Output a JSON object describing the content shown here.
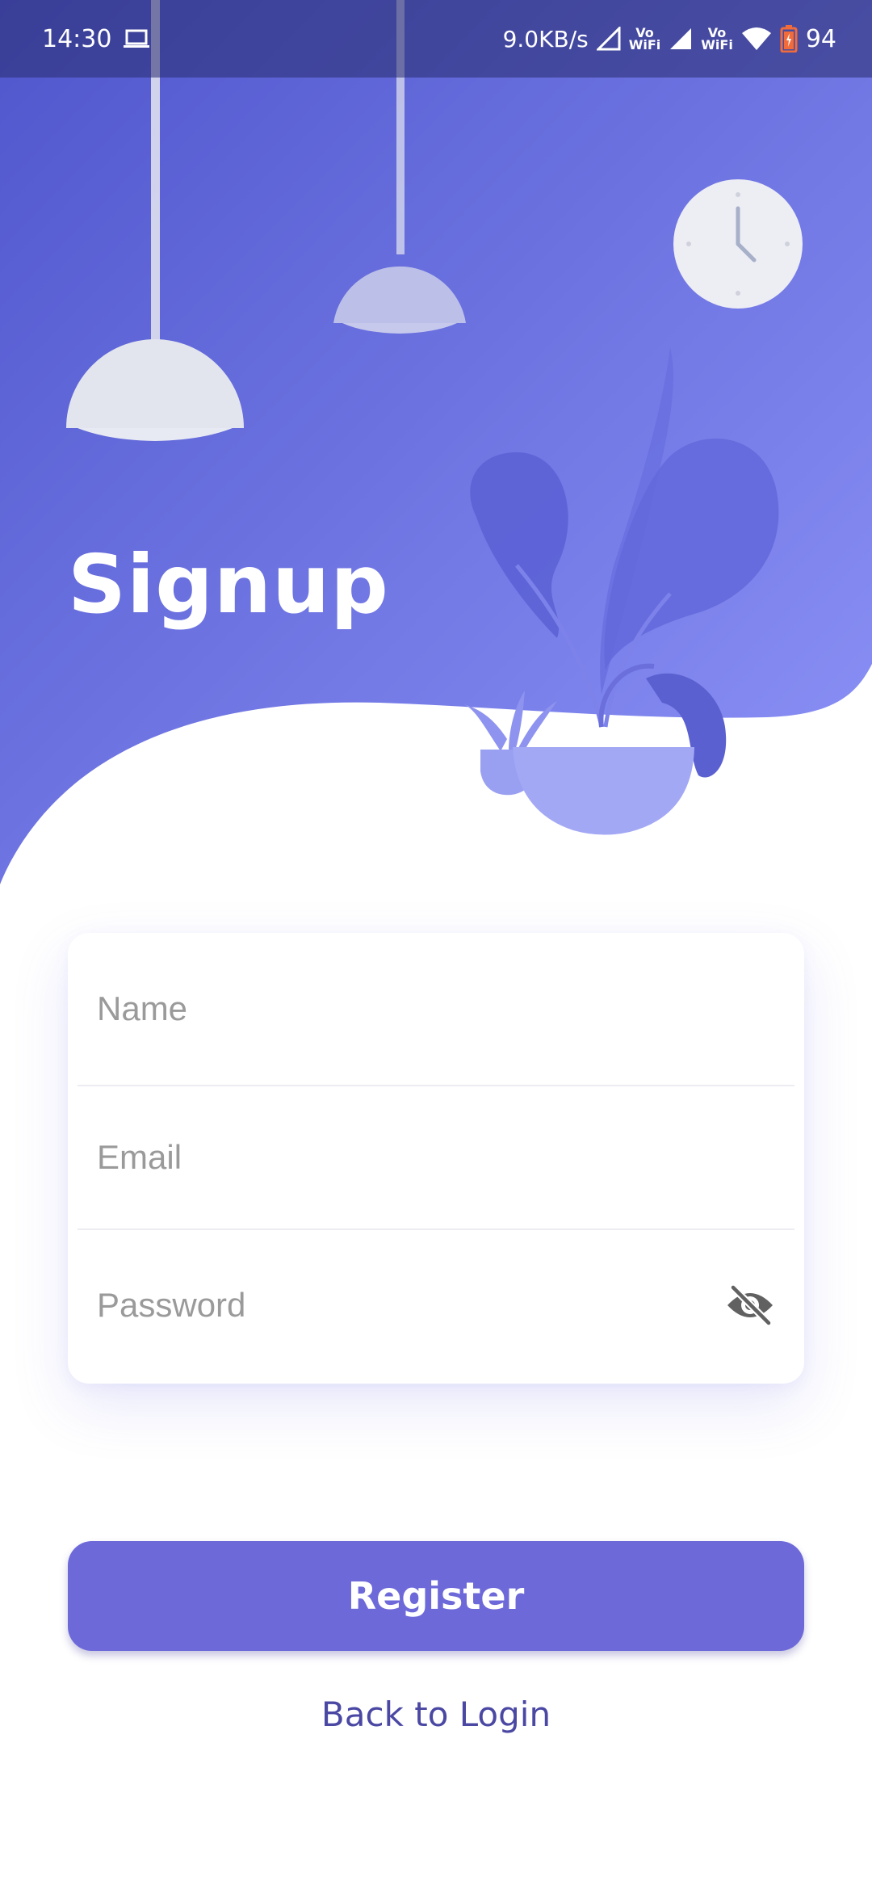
{
  "status_bar": {
    "time": "14:30",
    "network_speed": "9.0KB/s",
    "vowifi_line1": "Vo",
    "vowifi_line2": "WiFi",
    "battery_level": "94"
  },
  "header": {
    "title": "Signup"
  },
  "form": {
    "name_placeholder": "Name",
    "name_value": "",
    "email_placeholder": "Email",
    "email_value": "",
    "password_placeholder": "Password",
    "password_value": ""
  },
  "actions": {
    "register_label": "Register",
    "back_label": "Back to Login"
  },
  "colors": {
    "primary": "#6d69d9",
    "link": "#4a48a3",
    "hero_gradient_start": "#4f56cc",
    "hero_gradient_end": "#8a8ff5"
  }
}
